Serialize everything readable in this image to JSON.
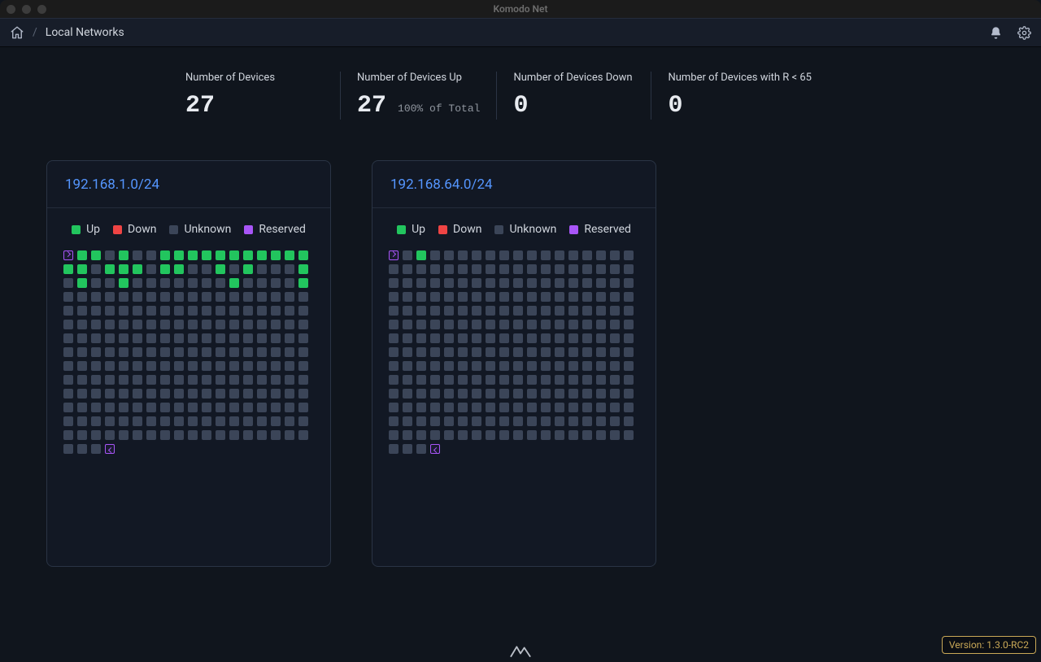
{
  "window": {
    "title": "Komodo Net"
  },
  "breadcrumb": {
    "page": "Local Networks"
  },
  "stats": [
    {
      "label": "Number of Devices",
      "value": "27",
      "sub": ""
    },
    {
      "label": "Number of Devices Up",
      "value": "27",
      "sub": "100% of Total"
    },
    {
      "label": "Number of Devices Down",
      "value": "0",
      "sub": ""
    },
    {
      "label": "Number of Devices with R < 65",
      "value": "0",
      "sub": ""
    }
  ],
  "legend": {
    "up": "Up",
    "down": "Down",
    "unknown": "Unknown",
    "reserved": "Reserved"
  },
  "networks": [
    {
      "cidr": "192.168.1.0/24",
      "total": 256,
      "cols": 18,
      "reserved_first": 0,
      "reserved_last": 255,
      "up_indices": [
        1,
        2,
        4,
        7,
        8,
        9,
        10,
        11,
        12,
        13,
        14,
        15,
        16,
        17,
        18,
        19,
        21,
        22,
        23,
        25,
        26,
        29,
        31,
        35,
        37,
        40,
        48,
        53
      ]
    },
    {
      "cidr": "192.168.64.0/24",
      "total": 256,
      "cols": 18,
      "reserved_first": 0,
      "reserved_last": 255,
      "up_indices": [
        2
      ]
    }
  ],
  "version": {
    "label": "Version: 1.3.0-RC2"
  }
}
